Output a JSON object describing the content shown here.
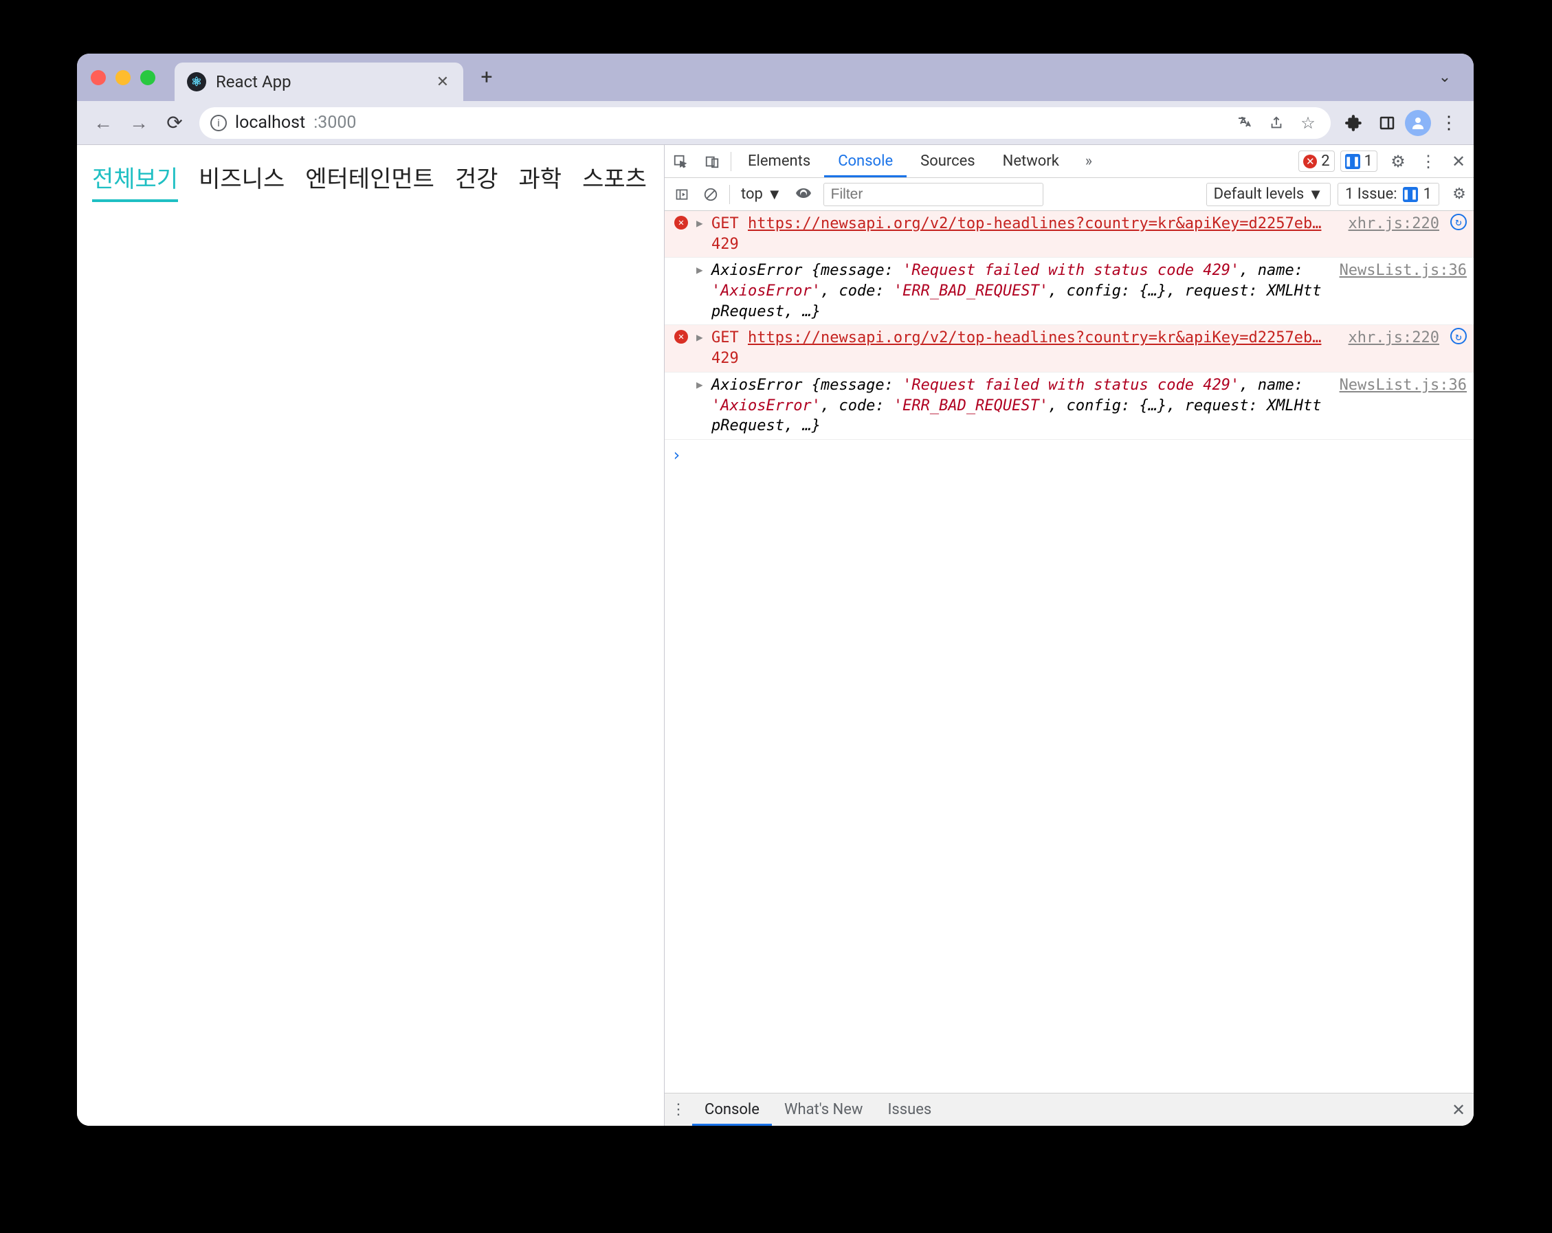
{
  "browser": {
    "tab_title": "React App",
    "url_host": "localhost",
    "url_port": ":3000"
  },
  "page": {
    "categories": [
      "전체보기",
      "비즈니스",
      "엔터테인먼트",
      "건강",
      "과학",
      "스포츠"
    ],
    "active_category_index": 0
  },
  "devtools": {
    "tabs": [
      "Elements",
      "Console",
      "Sources",
      "Network"
    ],
    "active_tab": "Console",
    "error_count": "2",
    "info_count": "1",
    "console_toolbar": {
      "context": "top",
      "filter_placeholder": "Filter",
      "levels": "Default levels",
      "issues_label": "1 Issue:",
      "issues_count": "1"
    },
    "logs": [
      {
        "type": "error",
        "method": "GET",
        "url": "https://newsapi.org/v2/top-headlines?country=kr&apiKey=d2257eb…",
        "status": "429",
        "source": "xhr.js:220"
      },
      {
        "type": "object",
        "pre": "AxiosError ",
        "body_plain1": "{message: ",
        "msg_str": "'Request failed with status code 429'",
        "body_plain2": ", name: ",
        "name_str": "'AxiosError'",
        "body_plain3": ", code: ",
        "code_str": "'ERR_BAD_REQUEST'",
        "body_plain4": ", config: {…}, request: XMLHttpRequest, …}",
        "source": "NewsList.js:36"
      },
      {
        "type": "error",
        "method": "GET",
        "url": "https://newsapi.org/v2/top-headlines?country=kr&apiKey=d2257eb…",
        "status": "429",
        "source": "xhr.js:220"
      },
      {
        "type": "object",
        "pre": "AxiosError ",
        "body_plain1": "{message: ",
        "msg_str": "'Request failed with status code 429'",
        "body_plain2": ", name: ",
        "name_str": "'AxiosError'",
        "body_plain3": ", code: ",
        "code_str": "'ERR_BAD_REQUEST'",
        "body_plain4": ", config: {…}, request: XMLHttpRequest, …}",
        "source": "NewsList.js:36"
      }
    ],
    "drawer_tabs": [
      "Console",
      "What's New",
      "Issues"
    ],
    "drawer_active": "Console"
  }
}
